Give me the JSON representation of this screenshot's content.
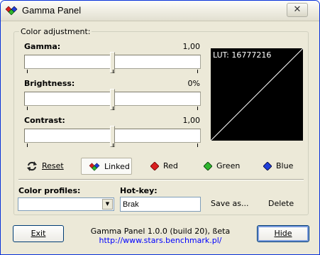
{
  "window": {
    "title": "Gamma Panel",
    "close_glyph": "✕"
  },
  "group": {
    "legend": "Color adjustment:"
  },
  "sliders": {
    "gamma": {
      "label": "Gamma:",
      "value_text": "1,00",
      "position": 0.5
    },
    "brightness": {
      "label": "Brightness:",
      "value_text": "0%",
      "position": 0.5
    },
    "contrast": {
      "label": "Contrast:",
      "value_text": "1,00",
      "position": 0.5
    }
  },
  "lut": {
    "label": "LUT: 16777216"
  },
  "channels": {
    "reset": "Reset",
    "linked": "Linked",
    "red": "Red",
    "green": "Green",
    "blue": "Blue"
  },
  "profiles": {
    "label": "Color profiles:",
    "selected": ""
  },
  "hotkey": {
    "label": "Hot-key:",
    "value": "Brak"
  },
  "actions": {
    "save_as": "Save as...",
    "delete": "Delete"
  },
  "footer": {
    "exit": "Exit",
    "version": "Gamma Panel 1.0.0 (build 20), ßeta",
    "url": "http://www.stars.benchmark.pl/",
    "hide": "Hide"
  },
  "colors": {
    "red": "#d91f1f",
    "green": "#2fb52f",
    "blue": "#1f3fd9",
    "link": "#0000ff"
  }
}
